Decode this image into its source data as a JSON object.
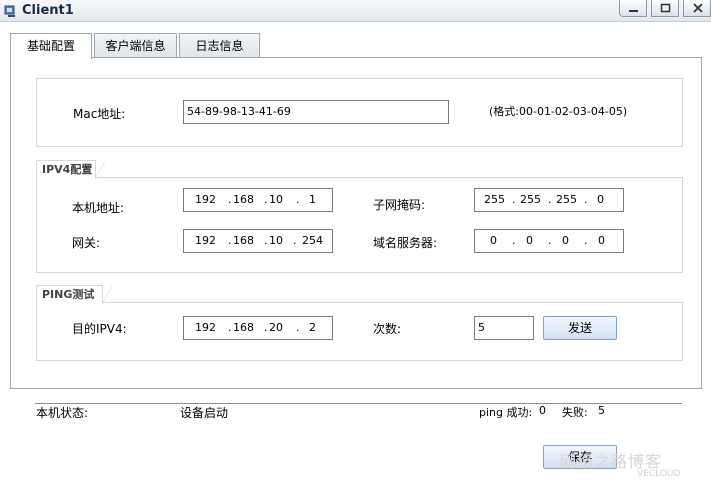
{
  "window": {
    "title": "Client1"
  },
  "tabs": [
    {
      "label": "基础配置",
      "active": true
    },
    {
      "label": "客户端信息",
      "active": false
    },
    {
      "label": "日志信息",
      "active": false
    }
  ],
  "mac": {
    "label": "Mac地址:",
    "value": "54-89-98-13-41-69",
    "format_hint": "(格式:00-01-02-03-04-05)"
  },
  "ipv4": {
    "legend": "IPV4配置",
    "local_address_label": "本机地址:",
    "local_address": [
      "192",
      "168",
      "10",
      "1"
    ],
    "subnet_mask_label": "子网掩码:",
    "subnet_mask": [
      "255",
      "255",
      "255",
      "0"
    ],
    "gateway_label": "网关:",
    "gateway": [
      "192",
      "168",
      "10",
      "254"
    ],
    "dns_label": "域名服务器:",
    "dns": [
      "0",
      "0",
      "0",
      "0"
    ]
  },
  "ping": {
    "legend": "PING测试",
    "target_label": "目的IPV4:",
    "target": [
      "192",
      "168",
      "20",
      "2"
    ],
    "count_label": "次数:",
    "count": "5",
    "send_label": "发送"
  },
  "status": {
    "label": "本机状态:",
    "value": "设备启动",
    "ping_success_label": "ping 成功:",
    "ping_success": "0",
    "fail_label": "失败:",
    "fail": "5"
  },
  "footer": {
    "button_label": "保存",
    "watermark": "网络之路博客",
    "watermark_sub": "VECLOUD"
  },
  "colors": {
    "accent": "#1b2a44",
    "border": "#9ea7b4",
    "group_border": "#d4d8de"
  }
}
